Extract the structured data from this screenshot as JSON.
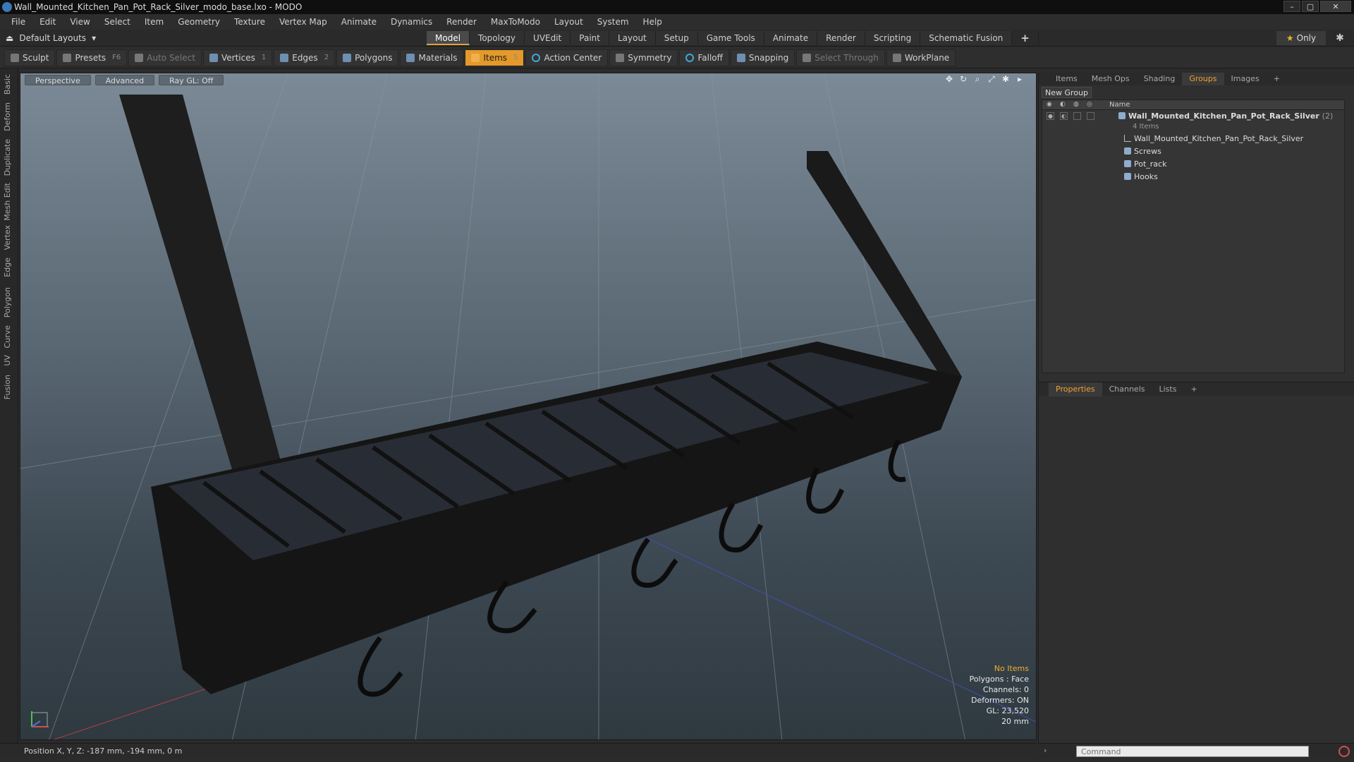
{
  "window": {
    "title": "Wall_Mounted_Kitchen_Pan_Pot_Rack_Silver_modo_base.lxo - MODO",
    "controls": [
      "–",
      "▢",
      "✕"
    ]
  },
  "menu": [
    "File",
    "Edit",
    "View",
    "Select",
    "Item",
    "Geometry",
    "Texture",
    "Vertex Map",
    "Animate",
    "Dynamics",
    "Render",
    "MaxToModo",
    "Layout",
    "System",
    "Help"
  ],
  "layout_selector": "Default Layouts",
  "tabs": [
    "Model",
    "Topology",
    "UVEdit",
    "Paint",
    "Layout",
    "Setup",
    "Game Tools",
    "Animate",
    "Render",
    "Scripting",
    "Schematic Fusion"
  ],
  "tab_plus": "+",
  "only_label": "Only",
  "toolbar": {
    "sculpt": "Sculpt",
    "presets": "Presets",
    "presets_key": "F6",
    "auto_select": "Auto Select",
    "vertices": "Vertices",
    "vertices_count": "1",
    "edges": "Edges",
    "edges_count": "2",
    "polygons": "Polygons",
    "materials": "Materials",
    "items": "Items",
    "items_count": "5",
    "action_center": "Action Center",
    "symmetry": "Symmetry",
    "falloff": "Falloff",
    "snapping": "Snapping",
    "select_through": "Select Through",
    "workplane": "WorkPlane"
  },
  "left_rail": [
    "Basic",
    "Deform",
    "Duplicate",
    "Mesh Edit",
    "Vertex",
    "Edge",
    "Polygon",
    "Curve",
    "UV",
    "Fusion"
  ],
  "viewport": {
    "view": "Perspective",
    "shading": "Advanced",
    "raygl": "Ray GL: Off",
    "stats": {
      "no_items": "No Items",
      "polygons": "Polygons : Face",
      "channels": "Channels: 0",
      "deformers": "Deformers: ON",
      "gl": "GL: 23,520",
      "scale": "20 mm"
    }
  },
  "status": {
    "position": "Position X, Y, Z:  -187 mm, -194 mm, 0 m"
  },
  "right_panel": {
    "tabs": [
      "Items",
      "Mesh Ops",
      "Shading",
      "Groups",
      "Images",
      "+"
    ],
    "new_group": "New Group",
    "name_col": "Name",
    "root": {
      "label": "Wall_Mounted_Kitchen_Pan_Pot_Rack_Silver",
      "count": "(2)",
      "sub": "4 Items"
    },
    "children": [
      "Wall_Mounted_Kitchen_Pan_Pot_Rack_Silver",
      "Screws",
      "Pot_rack",
      "Hooks"
    ],
    "props_tabs": [
      "Properties",
      "Channels",
      "Lists",
      "+"
    ]
  },
  "command": {
    "placeholder": "Command"
  },
  "colors": {
    "accent": "#e39a2a",
    "selected_tab": "#f0a030",
    "warn": "#f0b030"
  }
}
